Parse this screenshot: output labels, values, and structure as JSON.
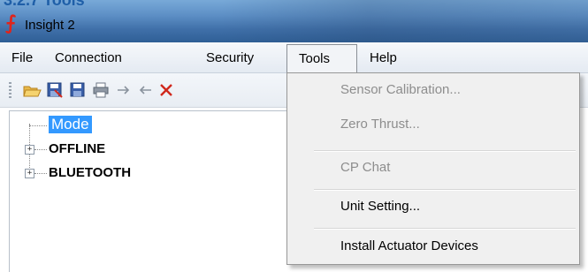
{
  "doc_heading": "3.2.7 Tools",
  "window": {
    "title": "Insight 2",
    "icon": "app-logo-icon",
    "icon_glyph": "⨍",
    "icon_color": "#e0241b"
  },
  "menubar": {
    "items": [
      {
        "label": "File"
      },
      {
        "label": "Connection"
      },
      {
        "label": "Security"
      },
      {
        "label": "Tools"
      },
      {
        "label": "Help"
      }
    ],
    "active": "Tools"
  },
  "toolbar": {
    "buttons": [
      {
        "icon": "open-folder-icon"
      },
      {
        "icon": "save-as-icon"
      },
      {
        "icon": "save-icon"
      },
      {
        "icon": "print-icon"
      },
      {
        "icon": "arrow-right-icon"
      },
      {
        "icon": "arrow-left-icon"
      },
      {
        "icon": "delete-icon"
      }
    ]
  },
  "tree": {
    "nodes": [
      {
        "label": "Mode",
        "selected": true,
        "expander": ""
      },
      {
        "label": "OFFLINE",
        "expander": "+"
      },
      {
        "label": "BLUETOOTH",
        "expander": "+"
      }
    ]
  },
  "tools_menu": {
    "items": [
      {
        "label": "Sensor Calibration...",
        "enabled": false
      },
      {
        "label": "Zero Thrust...",
        "enabled": false
      },
      {
        "label": "CP Chat",
        "enabled": false
      },
      {
        "label": "Unit Setting...",
        "enabled": true
      },
      {
        "label": "Install Actuator Devices",
        "enabled": true
      }
    ]
  },
  "colors": {
    "selection": "#3399ff",
    "disabled_text": "#8d8d8d",
    "titlebar": "#3f6fa8"
  }
}
